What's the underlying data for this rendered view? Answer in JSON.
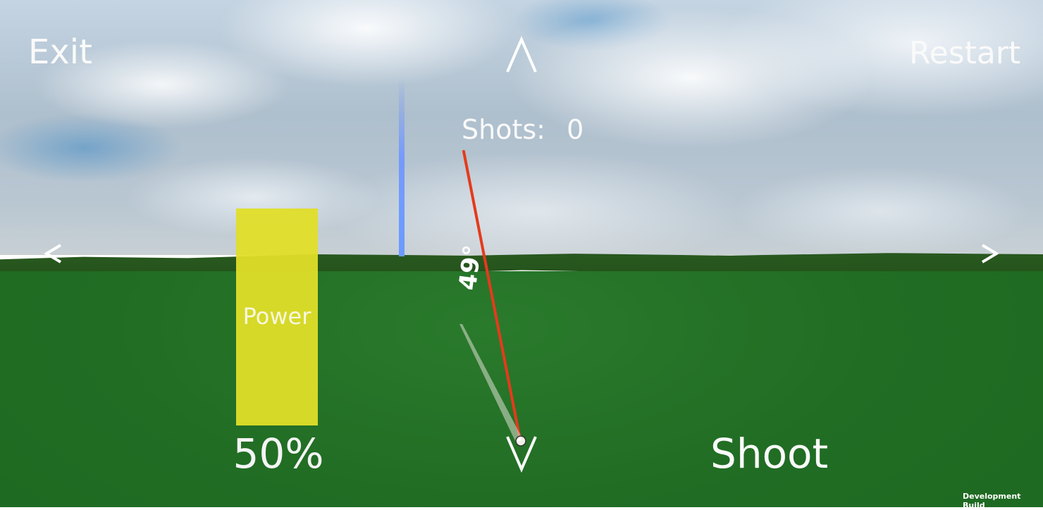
{
  "hud": {
    "exit_label": "Exit",
    "restart_label": "Restart",
    "shots_label": "Shots:",
    "shots_value": "0",
    "shoot_label": "Shoot",
    "power_label": "Power",
    "power_percent": "50%",
    "power_fraction": 0.5,
    "angle_label": "49°",
    "dev_build_label": "Development Build"
  },
  "icons": {
    "up": "chevron-up-icon",
    "down": "chevron-down-icon",
    "left": "chevron-left-icon",
    "right": "chevron-right-icon"
  },
  "colors": {
    "power_bar": "#e0de28",
    "aim_line": "#e53a1c",
    "height_marker": "#6a9bff",
    "ground": "#216d24"
  }
}
